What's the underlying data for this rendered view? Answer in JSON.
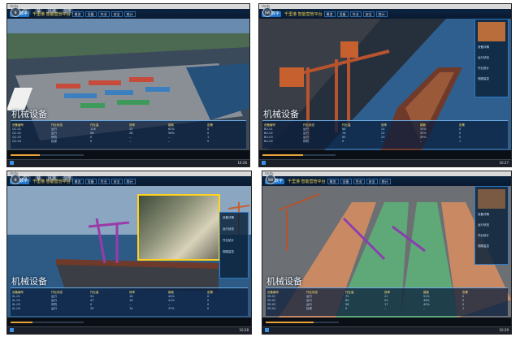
{
  "panels": [
    {
      "title_bar": "Unity",
      "logo": "港口数字",
      "app_title": "千里港 智能营管平台",
      "nav": [
        "概览",
        "设备",
        "作业",
        "安全",
        "统计"
      ],
      "weather": [
        "26°",
        "晴",
        "风速",
        "湿度"
      ],
      "section_title": "机械设备",
      "table": [
        {
          "head": "设备编号",
          "rows": [
            "QC-01",
            "QC-02",
            "QC-03",
            "QC-04"
          ]
        },
        {
          "head": "作业状态",
          "rows": [
            "运行",
            "运行",
            "停机",
            "检修"
          ]
        },
        {
          "head": "作业量",
          "rows": [
            "126",
            "98",
            "0",
            "0"
          ]
        },
        {
          "head": "效率",
          "rows": [
            "32",
            "28",
            "--",
            "--"
          ]
        },
        {
          "head": "能耗",
          "rows": [
            "62%",
            "58%",
            "--",
            "--"
          ]
        },
        {
          "head": "告警",
          "rows": [
            "0",
            "0",
            "1",
            "0"
          ]
        }
      ],
      "clock": "10:26"
    },
    {
      "title_bar": "Unity",
      "logo": "港口数字",
      "app_title": "千里港 智能营管平台",
      "nav": [
        "概览",
        "设备",
        "作业",
        "安全",
        "统计"
      ],
      "compass": "SW",
      "section_title": "机械设备",
      "side_panel": [
        "设备详情",
        "运行状态",
        "作业统计",
        "视频监控"
      ],
      "table": [
        {
          "head": "设备编号",
          "rows": [
            "BU-01",
            "BU-02",
            "BU-03",
            "BU-04"
          ]
        },
        {
          "head": "作业状态",
          "rows": [
            "运行",
            "运行",
            "运行",
            "停机"
          ]
        },
        {
          "head": "作业量",
          "rows": [
            "88",
            "76",
            "65",
            "0"
          ]
        },
        {
          "head": "效率",
          "rows": [
            "24",
            "22",
            "20",
            "--"
          ]
        },
        {
          "head": "能耗",
          "rows": [
            "55%",
            "52%",
            "49%",
            "--"
          ]
        },
        {
          "head": "告警",
          "rows": [
            "0",
            "0",
            "0",
            "1"
          ]
        }
      ],
      "clock": "10:27"
    },
    {
      "title_bar": "Unity",
      "logo": "港口数字",
      "app_title": "千里港 智能营管平台",
      "nav": [
        "概览",
        "设备",
        "作业",
        "安全",
        "统计"
      ],
      "weather": [
        "26°",
        "晴",
        "风速",
        "湿度"
      ],
      "section_title": "机械设备",
      "side_panel": [
        "设备详情",
        "运行状态",
        "作业统计",
        "视频监控"
      ],
      "table": [
        {
          "head": "设备编号",
          "rows": [
            "SL-01",
            "SL-02",
            "SL-03",
            "SL-04"
          ]
        },
        {
          "head": "作业状态",
          "rows": [
            "运行",
            "运行",
            "停机",
            "运行"
          ]
        },
        {
          "head": "作业量",
          "rows": [
            "54",
            "47",
            "0",
            "39"
          ]
        },
        {
          "head": "效率",
          "rows": [
            "18",
            "16",
            "--",
            "14"
          ]
        },
        {
          "head": "能耗",
          "rows": [
            "44%",
            "41%",
            "--",
            "37%"
          ]
        },
        {
          "head": "告警",
          "rows": [
            "0",
            "0",
            "0",
            "0"
          ]
        }
      ],
      "clock": "10:28"
    },
    {
      "title_bar": "Unity",
      "logo": "港口数字",
      "app_title": "千里港 智能营管平台",
      "nav": [
        "概览",
        "设备",
        "作业",
        "安全",
        "统计"
      ],
      "compass": "SW",
      "section_title": "机械设备",
      "side_panel": [
        "设备详情",
        "运行状态",
        "作业统计",
        "视频监控"
      ],
      "table": [
        {
          "head": "设备编号",
          "rows": [
            "SR-01",
            "SR-02",
            "SR-03",
            "SR-04"
          ]
        },
        {
          "head": "作业状态",
          "rows": [
            "运行",
            "运行",
            "运行",
            "检修"
          ]
        },
        {
          "head": "作业量",
          "rows": [
            "72",
            "69",
            "58",
            "0"
          ]
        },
        {
          "head": "效率",
          "rows": [
            "21",
            "20",
            "17",
            "--"
          ]
        },
        {
          "head": "能耗",
          "rows": [
            "51%",
            "48%",
            "45%",
            "--"
          ]
        },
        {
          "head": "告警",
          "rows": [
            "0",
            "0",
            "0",
            "1"
          ]
        }
      ],
      "clock": "10:29"
    }
  ],
  "colors": {
    "accent": "#2d6fb0",
    "title_yellow": "#f2d24b",
    "table_head": "#ffe07a",
    "taskbar": "#1b1f27"
  },
  "icons": [
    "compass-icon",
    "windows-start-icon",
    "weather-icon"
  ]
}
